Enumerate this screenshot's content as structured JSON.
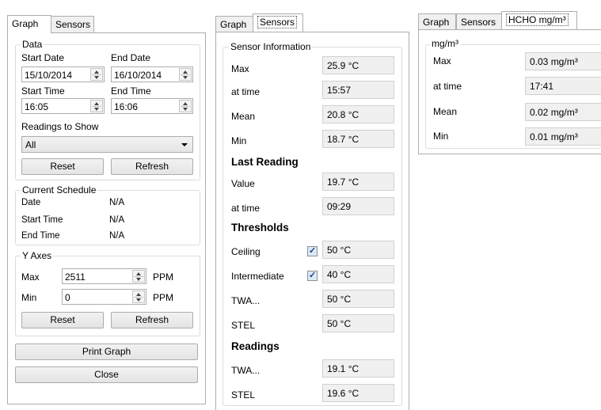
{
  "graph_panel": {
    "tabs": [
      {
        "label": "Graph",
        "active": true
      },
      {
        "label": "Sensors",
        "active": false
      }
    ],
    "data_group": {
      "title": "Data",
      "start_date_label": "Start Date",
      "end_date_label": "End Date",
      "start_date_value": "15/10/2014",
      "end_date_value": "16/10/2014",
      "start_time_label": "Start Time",
      "end_time_label": "End Time",
      "start_time_value": "16:05",
      "end_time_value": "16:06",
      "readings_label": "Readings to Show",
      "readings_value": "All",
      "reset_label": "Reset",
      "refresh_label": "Refresh"
    },
    "schedule_group": {
      "title": "Current Schedule",
      "date_label": "Date",
      "date_value": "N/A",
      "start_label": "Start Time",
      "start_value": "N/A",
      "end_label": "End Time",
      "end_value": "N/A"
    },
    "y_axes_group": {
      "title": "Y Axes",
      "max_label": "Max",
      "max_value": "2511",
      "max_unit": "PPM",
      "min_label": "Min",
      "min_value": "0",
      "min_unit": "PPM",
      "reset_label": "Reset",
      "refresh_label": "Refresh"
    },
    "print_label": "Print Graph",
    "close_label": "Close"
  },
  "sensors_panel": {
    "tabs": [
      {
        "label": "Graph",
        "active": false
      },
      {
        "label": "Sensors",
        "active": true
      }
    ],
    "group_title": "Sensor Information",
    "max_label": "Max",
    "max_value": "25.9 °C",
    "max_time_label": "at time",
    "max_time_value": "15:57",
    "mean_label": "Mean",
    "mean_value": "20.8 °C",
    "min_label": "Min",
    "min_value": "18.7 °C",
    "last_heading": "Last Reading",
    "last_value_label": "Value",
    "last_value": "19.7 °C",
    "last_time_label": "at time",
    "last_time_value": "09:29",
    "thresholds_heading": "Thresholds",
    "ceiling_label": "Ceiling",
    "ceiling_checked": true,
    "ceiling_value": "50 °C",
    "intermediate_label": "Intermediate",
    "intermediate_checked": true,
    "intermediate_value": "40 °C",
    "twa_label": "TWA...",
    "twa_value": "50 °C",
    "stel_label": "STEL",
    "stel_value": "50 °C",
    "readings_heading": "Readings",
    "r_twa_label": "TWA...",
    "r_twa_value": "19.1 °C",
    "r_stel_label": "STEL",
    "r_stel_value": "19.6 °C"
  },
  "hcho_panel": {
    "tabs": [
      {
        "label": "Graph",
        "active": false
      },
      {
        "label": "Sensors",
        "active": false
      },
      {
        "label": "HCHO mg/m³",
        "active": true
      }
    ],
    "group_title": "mg/m³",
    "max_label": "Max",
    "max_value": "0.03 mg/m³",
    "time_label": "at time",
    "time_value": "17:41",
    "mean_label": "Mean",
    "mean_value": "0.02 mg/m³",
    "min_label": "Min",
    "min_value": "0.01 mg/m³"
  }
}
